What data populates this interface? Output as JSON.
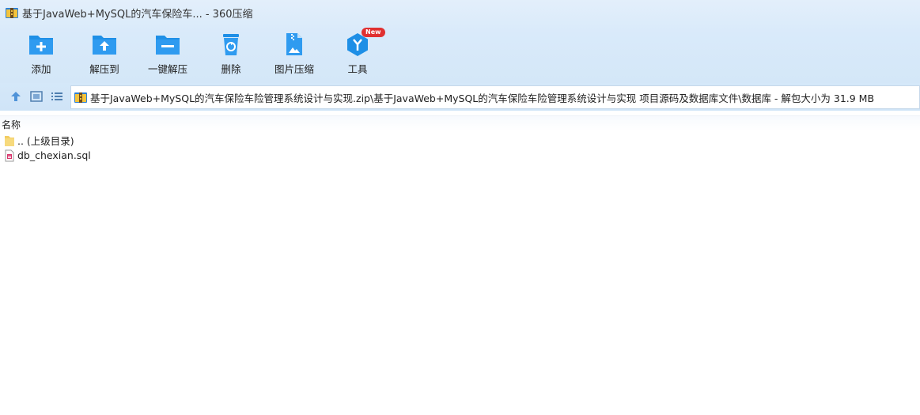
{
  "window": {
    "title": "基于JavaWeb+MySQL的汽车保险车... - 360压缩"
  },
  "toolbar": {
    "items": [
      {
        "label": "添加",
        "icon": "add-folder-icon"
      },
      {
        "label": "解压到",
        "icon": "extract-to-icon"
      },
      {
        "label": "一键解压",
        "icon": "one-click-extract-icon"
      },
      {
        "label": "删除",
        "icon": "recycle-bin-icon"
      },
      {
        "label": "图片压缩",
        "icon": "image-compress-icon"
      },
      {
        "label": "工具",
        "icon": "tools-icon",
        "badge": "New"
      }
    ]
  },
  "nav": {
    "up_icon": "up-arrow-icon",
    "view_icon": "thumbnail-view-icon",
    "list_icon": "list-view-icon"
  },
  "address": {
    "path": "基于JavaWeb+MySQL的汽车保险车险管理系统设计与实现.zip\\基于JavaWeb+MySQL的汽车保险车险管理系统设计与实现 项目源码及数据库文件\\数据库 - 解包大小为 31.9 MB"
  },
  "list": {
    "column_name": "名称",
    "rows": [
      {
        "name": ".. (上级目录)",
        "icon": "folder-icon"
      },
      {
        "name": "db_chexian.sql",
        "icon": "sql-file-icon"
      }
    ]
  },
  "colors": {
    "header_bg": "#d9eafa",
    "accent_blue": "#1e8fe6",
    "badge_red": "#e03030"
  }
}
